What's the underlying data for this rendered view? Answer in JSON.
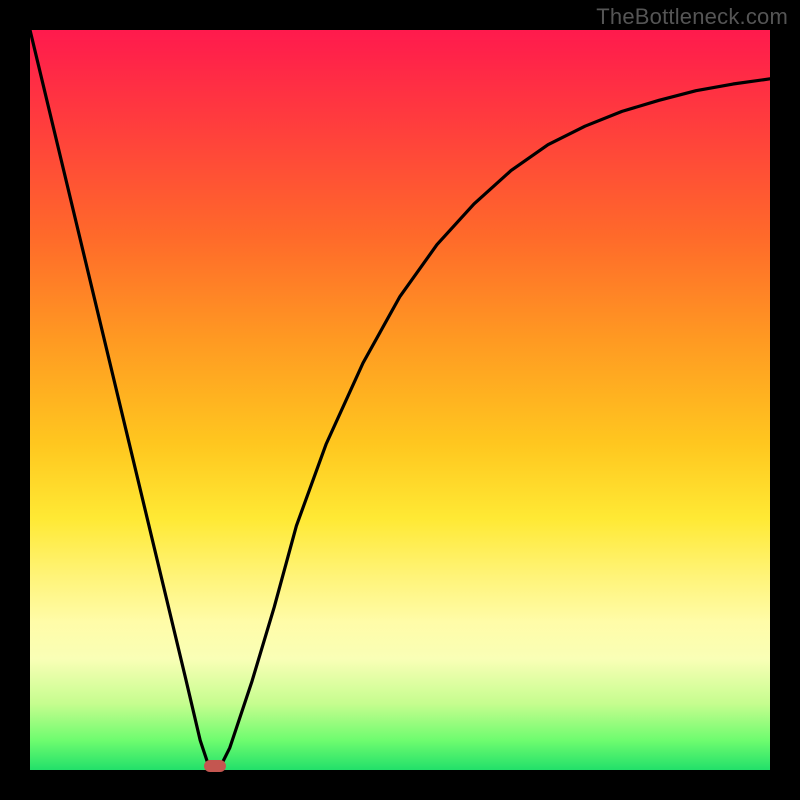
{
  "watermark": "TheBottleneck.com",
  "colors": {
    "frame": "#000000",
    "curve": "#000000",
    "marker": "#c45650",
    "gradient_stops": [
      "#ff1a4d",
      "#ff3b3e",
      "#ff6a2a",
      "#ff9a22",
      "#ffc71f",
      "#ffe934",
      "#fff47a",
      "#fffca8",
      "#f9ffb6",
      "#c6fd8f",
      "#6efc6f",
      "#22e06a"
    ]
  },
  "chart_data": {
    "type": "line",
    "title": "",
    "xlabel": "",
    "ylabel": "",
    "xlim": [
      0,
      100
    ],
    "ylim": [
      0,
      100
    ],
    "note": "x and y expressed as percentages of the plot area. y=0 is bottom, y=100 is top. Curve traced from pixels.",
    "x": [
      0,
      3,
      6,
      9,
      12,
      15,
      18,
      21,
      23,
      24,
      25,
      26,
      27,
      28,
      30,
      33,
      36,
      40,
      45,
      50,
      55,
      60,
      65,
      70,
      75,
      80,
      85,
      90,
      95,
      100
    ],
    "y": [
      100,
      87.5,
      75,
      62.5,
      50,
      37.5,
      25,
      12.5,
      4,
      1,
      0,
      1,
      3,
      6,
      12,
      22,
      33,
      44,
      55,
      64,
      71,
      76.5,
      81,
      84.5,
      87,
      89,
      90.5,
      91.8,
      92.7,
      93.4
    ],
    "marker": {
      "x_pct": 25,
      "y_pct": 0
    }
  }
}
